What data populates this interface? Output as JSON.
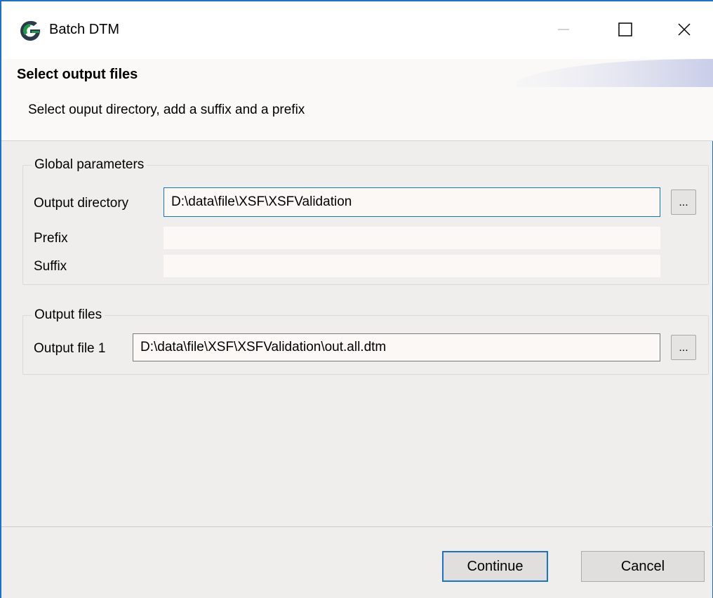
{
  "window": {
    "title": "Batch DTM",
    "app_icon": "g-logo-icon",
    "controls": {
      "minimize_icon": "minimize-icon",
      "maximize_icon": "maximize-icon",
      "close_icon": "close-icon"
    }
  },
  "header": {
    "title": "Select output files",
    "subtitle": "Select ouput directory, add a suffix and a prefix"
  },
  "global_parameters": {
    "legend": "Global parameters",
    "output_directory": {
      "label": "Output directory",
      "value": "D:\\data\\file\\XSF\\XSFValidation",
      "browse_label": "..."
    },
    "prefix": {
      "label": "Prefix",
      "value": ""
    },
    "suffix": {
      "label": "Suffix",
      "value": ""
    }
  },
  "output_files": {
    "legend": "Output files",
    "files": [
      {
        "label": "Output file 1",
        "value": "D:\\data\\file\\XSF\\XSFValidation\\out.all.dtm",
        "browse_label": "..."
      }
    ]
  },
  "footer": {
    "continue_label": "Continue",
    "cancel_label": "Cancel"
  },
  "colors": {
    "accent": "#1a73c8",
    "background": "#f0eeec",
    "logo_green": "#1f9a4a",
    "logo_dark": "#2b3a4a"
  }
}
